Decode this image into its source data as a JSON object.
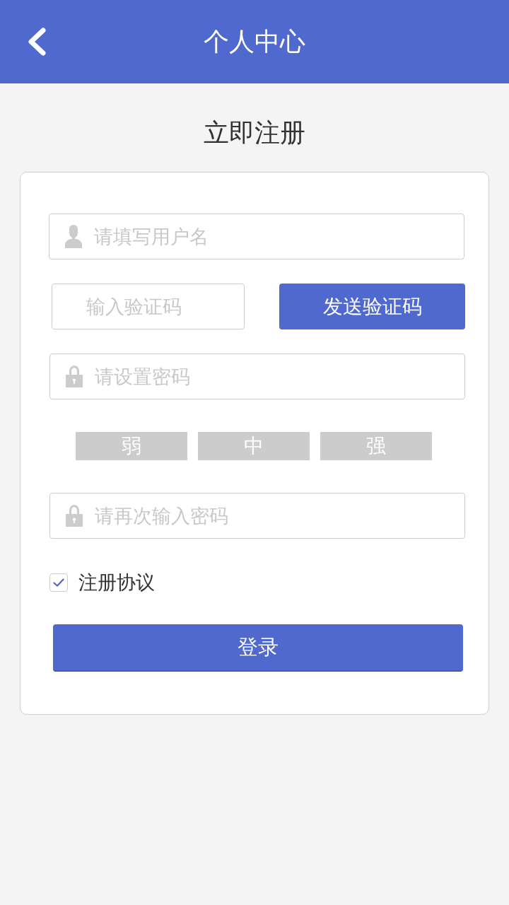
{
  "header": {
    "title": "个人中心"
  },
  "heading": "立即注册",
  "form": {
    "username": {
      "placeholder": "请填写用户名"
    },
    "code": {
      "placeholder": "输入验证码"
    },
    "send_code_button": "发送验证码",
    "password": {
      "placeholder": "请设置密码"
    },
    "strength": [
      {
        "label": "弱",
        "active": false
      },
      {
        "label": "中",
        "active": false
      },
      {
        "label": "强",
        "active": false
      }
    ],
    "confirm_password": {
      "placeholder": "请再次输入密码"
    },
    "agreement": {
      "label": "注册协议",
      "checked": true
    },
    "submit_button": "登录"
  }
}
